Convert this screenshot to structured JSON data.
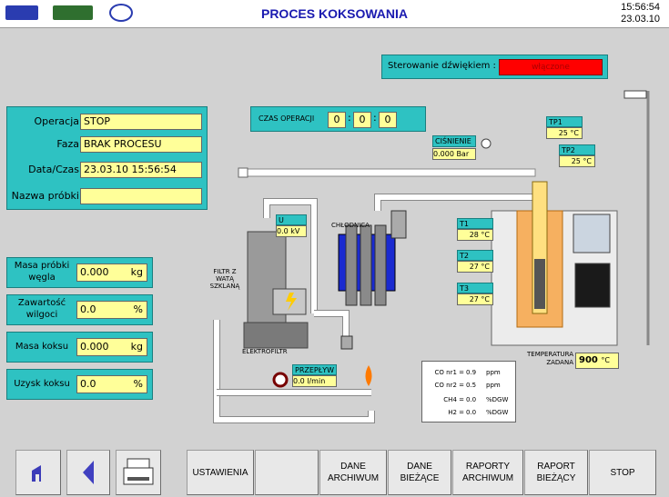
{
  "header": {
    "title": "PROCES KOKSOWANIA",
    "time": "15:56:54",
    "date": "23.03.10"
  },
  "sound_control": {
    "label": "Sterowanie dźwiękiem :",
    "value": "włączone",
    "value_color": "#ff0000"
  },
  "operation_time": {
    "label": "CZAS OPERACJI",
    "h": "0",
    "m": "0",
    "s": "0"
  },
  "process_panel": {
    "operacja_label": "Operacja",
    "operacja_value": "STOP",
    "faza_label": "Faza",
    "faza_value": "BRAK PROCESU",
    "datetime_label": "Data/Czas",
    "datetime_value": "23.03.10 15:56:54",
    "sample_label": "Nazwa próbki",
    "sample_value": ""
  },
  "measurements": {
    "masa_probki": {
      "label": "Masa próbki węgla",
      "value": "0.000",
      "unit": "kg"
    },
    "zawartosc": {
      "label": "Zawartość wilgoci",
      "value": "0.0",
      "unit": "%"
    },
    "masa_koksu": {
      "label": "Masa koksu",
      "value": "0.000",
      "unit": "kg"
    },
    "uzysk": {
      "label": "Uzysk koksu",
      "value": "0.0",
      "unit": "%"
    }
  },
  "diagram": {
    "cisnienie": {
      "label": "CIŚNIENIE",
      "value": "0.000 Bar"
    },
    "voltage": {
      "label": "U",
      "value": "0.0 kV"
    },
    "chlodnica": "CHŁODNICA",
    "filtr": "FILTR Z WATĄ SZKLANĄ",
    "elektrofiltr": "ELEKTROFILTR",
    "przeplyw": {
      "label": "PRZEPŁYW",
      "value": "0.0 l/min"
    },
    "tp1": {
      "label": "TP1",
      "value": "25 °C"
    },
    "tp2": {
      "label": "TP2",
      "value": "25 °C"
    },
    "t1": {
      "label": "T1",
      "value": "28 °C"
    },
    "t2": {
      "label": "T2",
      "value": "27 °C"
    },
    "t3": {
      "label": "T3",
      "value": "27 °C"
    },
    "temp_zadana": {
      "label": "TEMPERATURA ZADANA",
      "value": "900",
      "unit": "°C"
    },
    "gas": [
      {
        "label": "CO nr1 =",
        "value": "0.9",
        "unit": "ppm"
      },
      {
        "label": "CO nr2 =",
        "value": "0.5",
        "unit": "ppm"
      },
      {
        "label": "CH4 =",
        "value": "0.0",
        "unit": "%DGW"
      },
      {
        "label": "H2 =",
        "value": "0.0",
        "unit": "%DGW"
      }
    ]
  },
  "toolbar": {
    "ustawienia": "USTAWIENIA",
    "empty": "",
    "dane_archiwum": "DANE\nARCHIWUM",
    "dane_biezace": "DANE\nBIEŻĄCE",
    "raporty_archiwum": "RAPORTY\nARCHIWUM",
    "raport_biezacy": "RAPORT\nBIEŻĄCY",
    "stop": "STOP"
  },
  "colors": {
    "teal": "#2ec2c2",
    "field": "#ffff99",
    "title": "#1a1ab0"
  }
}
